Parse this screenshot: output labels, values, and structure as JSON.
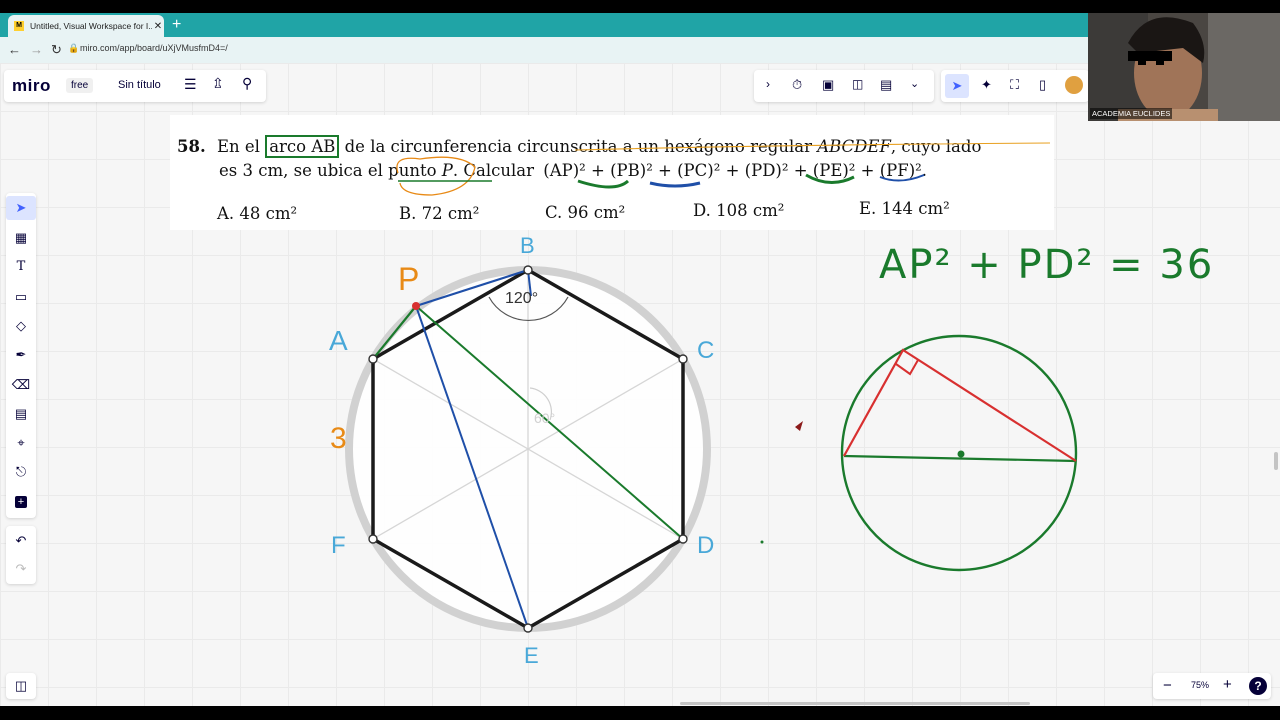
{
  "browser": {
    "tab_title": "Untitled, Visual Workspace for I...",
    "tab_close": "✕",
    "new_tab": "+",
    "url": "miro.com/app/board/uXjVMusfmD4=/"
  },
  "miro": {
    "logo": "miro",
    "plan": "free",
    "board_title": "Sin título",
    "zoom": "75%",
    "zoom_out": "−",
    "zoom_in": "+",
    "help": "?"
  },
  "webcam": {
    "label": "ACADEMIA EUCLIDES"
  },
  "problem": {
    "number": "58.",
    "line1_a": "En el",
    "line1_boxed": "arco AB",
    "line1_b": "de la circunferencia circunscrita a un hexágono regular",
    "line1_c": "ABCDEF",
    "line1_d": ", cuyo lado",
    "line2_a": "es 3 cm,",
    "line2_b": "se ubica el punto",
    "line2_c": "P",
    "line2_d": ". Calcular",
    "line2_e": "(AP)² + (PB)² + (PC)² + (PD)² + (PE)² + (PF)².",
    "options": [
      {
        "letter": "A.",
        "value": "48 cm²"
      },
      {
        "letter": "B.",
        "value": "72 cm²"
      },
      {
        "letter": "C.",
        "value": "96 cm²"
      },
      {
        "letter": "D.",
        "value": "108 cm²"
      },
      {
        "letter": "E.",
        "value": "144 cm²"
      }
    ]
  },
  "figure": {
    "labels": {
      "A": "A",
      "B": "B",
      "C": "C",
      "D": "D",
      "E": "E",
      "F": "F",
      "P": "P",
      "side": "3"
    },
    "angle_120": "120°",
    "angle_60": "60°"
  },
  "handwriting": {
    "equation": "AP² + PD² = 36"
  },
  "colors": {
    "accent": "#4262ff",
    "teal": "#20a4a6",
    "green": "#1a7a2c",
    "blue": "#1f4fa8",
    "red": "#d83030",
    "orange": "#e88a16",
    "label_blue": "#49a8d8"
  }
}
